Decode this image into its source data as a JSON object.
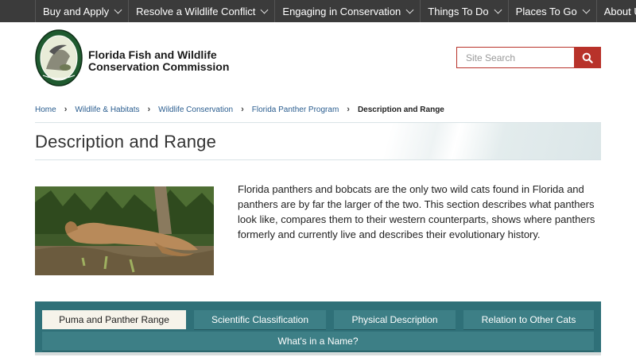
{
  "nav": {
    "items": [
      {
        "label": "Buy and Apply"
      },
      {
        "label": "Resolve a Wildlife Conflict"
      },
      {
        "label": "Engaging in Conservation"
      },
      {
        "label": "Things To Do"
      },
      {
        "label": "Places To Go"
      },
      {
        "label": "About Us"
      }
    ]
  },
  "header": {
    "agency_line1": "Florida Fish and Wildlife",
    "agency_line2": "Conservation Commission",
    "logo_text": "FLORIDA FISH AND WILDLIFE CONSERVATION COMMISSION"
  },
  "search": {
    "placeholder": "Site Search"
  },
  "breadcrumb": {
    "items": [
      "Home",
      "Wildlife & Habitats",
      "Wildlife Conservation",
      "Florida Panther Program"
    ],
    "current": "Description and Range"
  },
  "page": {
    "title": "Description and Range",
    "intro": "Florida panthers and bobcats are the only two wild cats found in Florida and panthers are by far the larger of the two.  This section describes what panthers look like, compares them to their western counterparts, shows where panthers formerly and currently live and describes their evolutionary history."
  },
  "tabs": {
    "items": [
      {
        "label": "Puma and Panther Range",
        "active": true
      },
      {
        "label": "Scientific Classification",
        "active": false
      },
      {
        "label": "Physical Description",
        "active": false
      },
      {
        "label": "Relation to Other Cats",
        "active": false
      },
      {
        "label": "What's in a Name?",
        "active": false
      }
    ]
  },
  "colors": {
    "nav_bg": "#3b3b3b",
    "accent_red": "#b8322a",
    "tab_panel": "#2f7078",
    "tab_active": "#f6f3ea",
    "link": "#2a5d8f"
  }
}
